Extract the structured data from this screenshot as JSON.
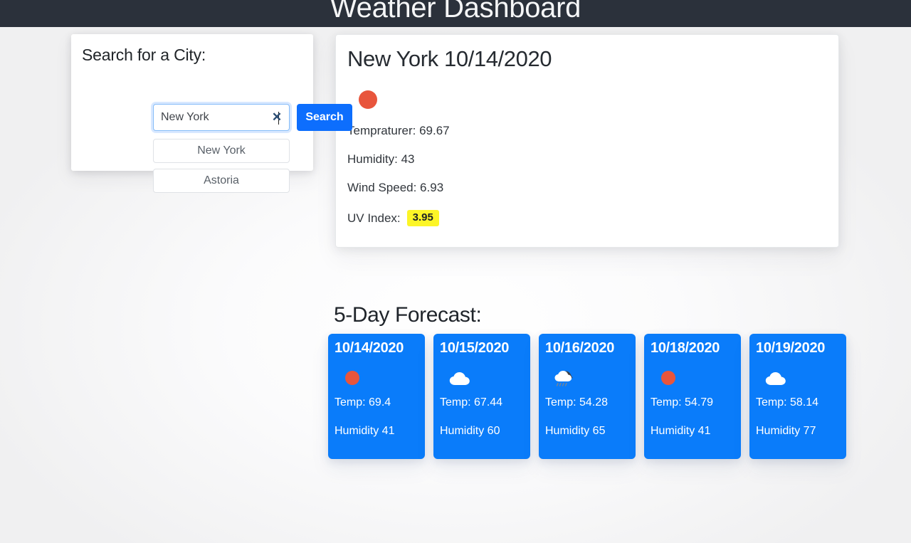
{
  "header": {
    "title": "Weather Dashboard",
    "bg_color": "#2b313b"
  },
  "search": {
    "heading": "Search for a City:",
    "input_value": "New York",
    "input_placeholder": "",
    "clear_icon": "close-x-icon",
    "button_label": "Search",
    "button_color": "#0d6efd",
    "history": [
      {
        "label": "New York"
      },
      {
        "label": "Astoria"
      }
    ]
  },
  "current": {
    "title": "New York 10/14/2020",
    "icon": "sun-icon",
    "icon_color": "#e8553c",
    "temperature": "Tempraturer: 69.67",
    "humidity": "Humidity: 43",
    "wind_speed": "Wind Speed: 6.93",
    "uv_label": "UV Index:",
    "uv_value": "3.95",
    "uv_badge_color": "#fcf527"
  },
  "forecast": {
    "heading": "5-Day Forecast:",
    "card_color": "#0a7cfa",
    "days": [
      {
        "date": "10/14/2020",
        "icon": "sun-icon",
        "temp": "Temp: 69.4",
        "humidity": "Humidity 41"
      },
      {
        "date": "10/15/2020",
        "icon": "cloud-icon",
        "temp": "Temp: 67.44",
        "humidity": "Humidity 60"
      },
      {
        "date": "10/16/2020",
        "icon": "rain-cloud-icon",
        "temp": "Temp: 54.28",
        "humidity": "Humidity 65"
      },
      {
        "date": "10/18/2020",
        "icon": "sun-icon",
        "temp": "Temp: 54.79",
        "humidity": "Humidity 41"
      },
      {
        "date": "10/19/2020",
        "icon": "cloud-icon",
        "temp": "Temp: 58.14",
        "humidity": "Humidity 77"
      }
    ]
  }
}
